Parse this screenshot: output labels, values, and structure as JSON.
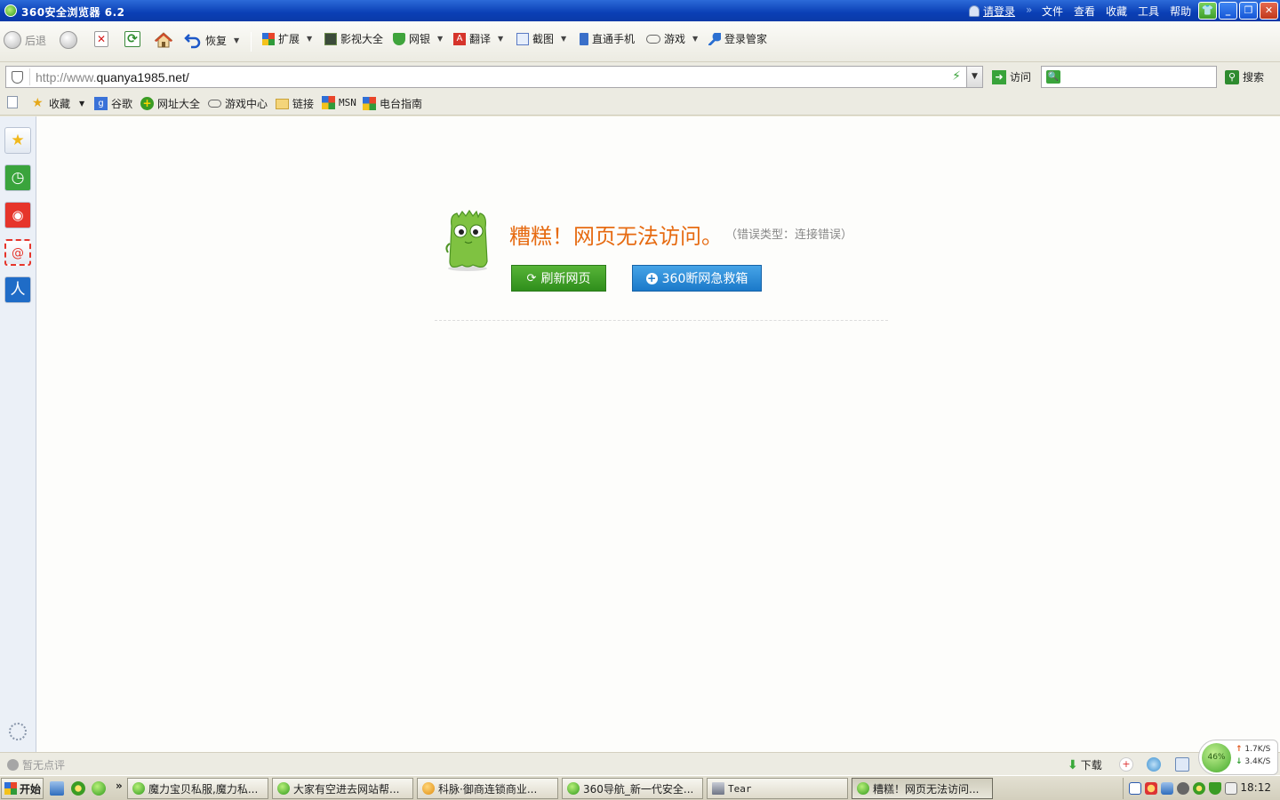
{
  "window": {
    "title": "360安全浏览器 6.2",
    "login_link": "请登录",
    "menu": [
      "文件",
      "查看",
      "收藏",
      "工具",
      "帮助"
    ],
    "controls": [
      "minimize",
      "restore",
      "close"
    ]
  },
  "toolbar": {
    "back_label": "后退",
    "restore_label": "恢复",
    "extend_label": "扩展",
    "video_label": "影视大全",
    "bank_label": "网银",
    "translate_label": "翻译",
    "screenshot_label": "截图",
    "phone_label": "直通手机",
    "games_label": "游戏",
    "password_label": "登录管家"
  },
  "address": {
    "url_prefix": "http://www.",
    "url_host": "quanya1985.net/",
    "go_label": "访问",
    "search_placeholder": "",
    "search_label": "搜索"
  },
  "favorites": {
    "collect_label": "收藏",
    "items": [
      "谷歌",
      "网址大全",
      "游戏中心",
      "链接",
      "MSN",
      "电台指南"
    ]
  },
  "sidebar": {
    "items": [
      "favorites-star-icon",
      "history-clock-icon",
      "weibo-icon",
      "mail-icon",
      "renren-icon"
    ]
  },
  "error_page": {
    "title": "糟糕！网页无法访问。",
    "error_type": "（错误类型：连接错误）",
    "refresh_label": "刷新网页",
    "rescue_label": "360断网急救箱"
  },
  "status": {
    "comment_text": "暂无点评",
    "download_label": "下载",
    "speed_percent": "46%",
    "upload_speed": "1.7K/S",
    "download_speed": "3.4K/S"
  },
  "taskbar": {
    "start_label": "开始",
    "tasks": [
      "魔力宝贝私服,魔力私...",
      "大家有空进去网站帮...",
      "科脉·御商连锁商业...",
      "360导航_新一代安全...",
      "Tear",
      "糟糕！网页无法访问..."
    ],
    "clock": "18:12"
  },
  "colors": {
    "title_bar": "#0a3fb5",
    "error_title": "#e66b12",
    "refresh_button": "#3a9c24",
    "rescue_button": "#2a8ad6"
  }
}
